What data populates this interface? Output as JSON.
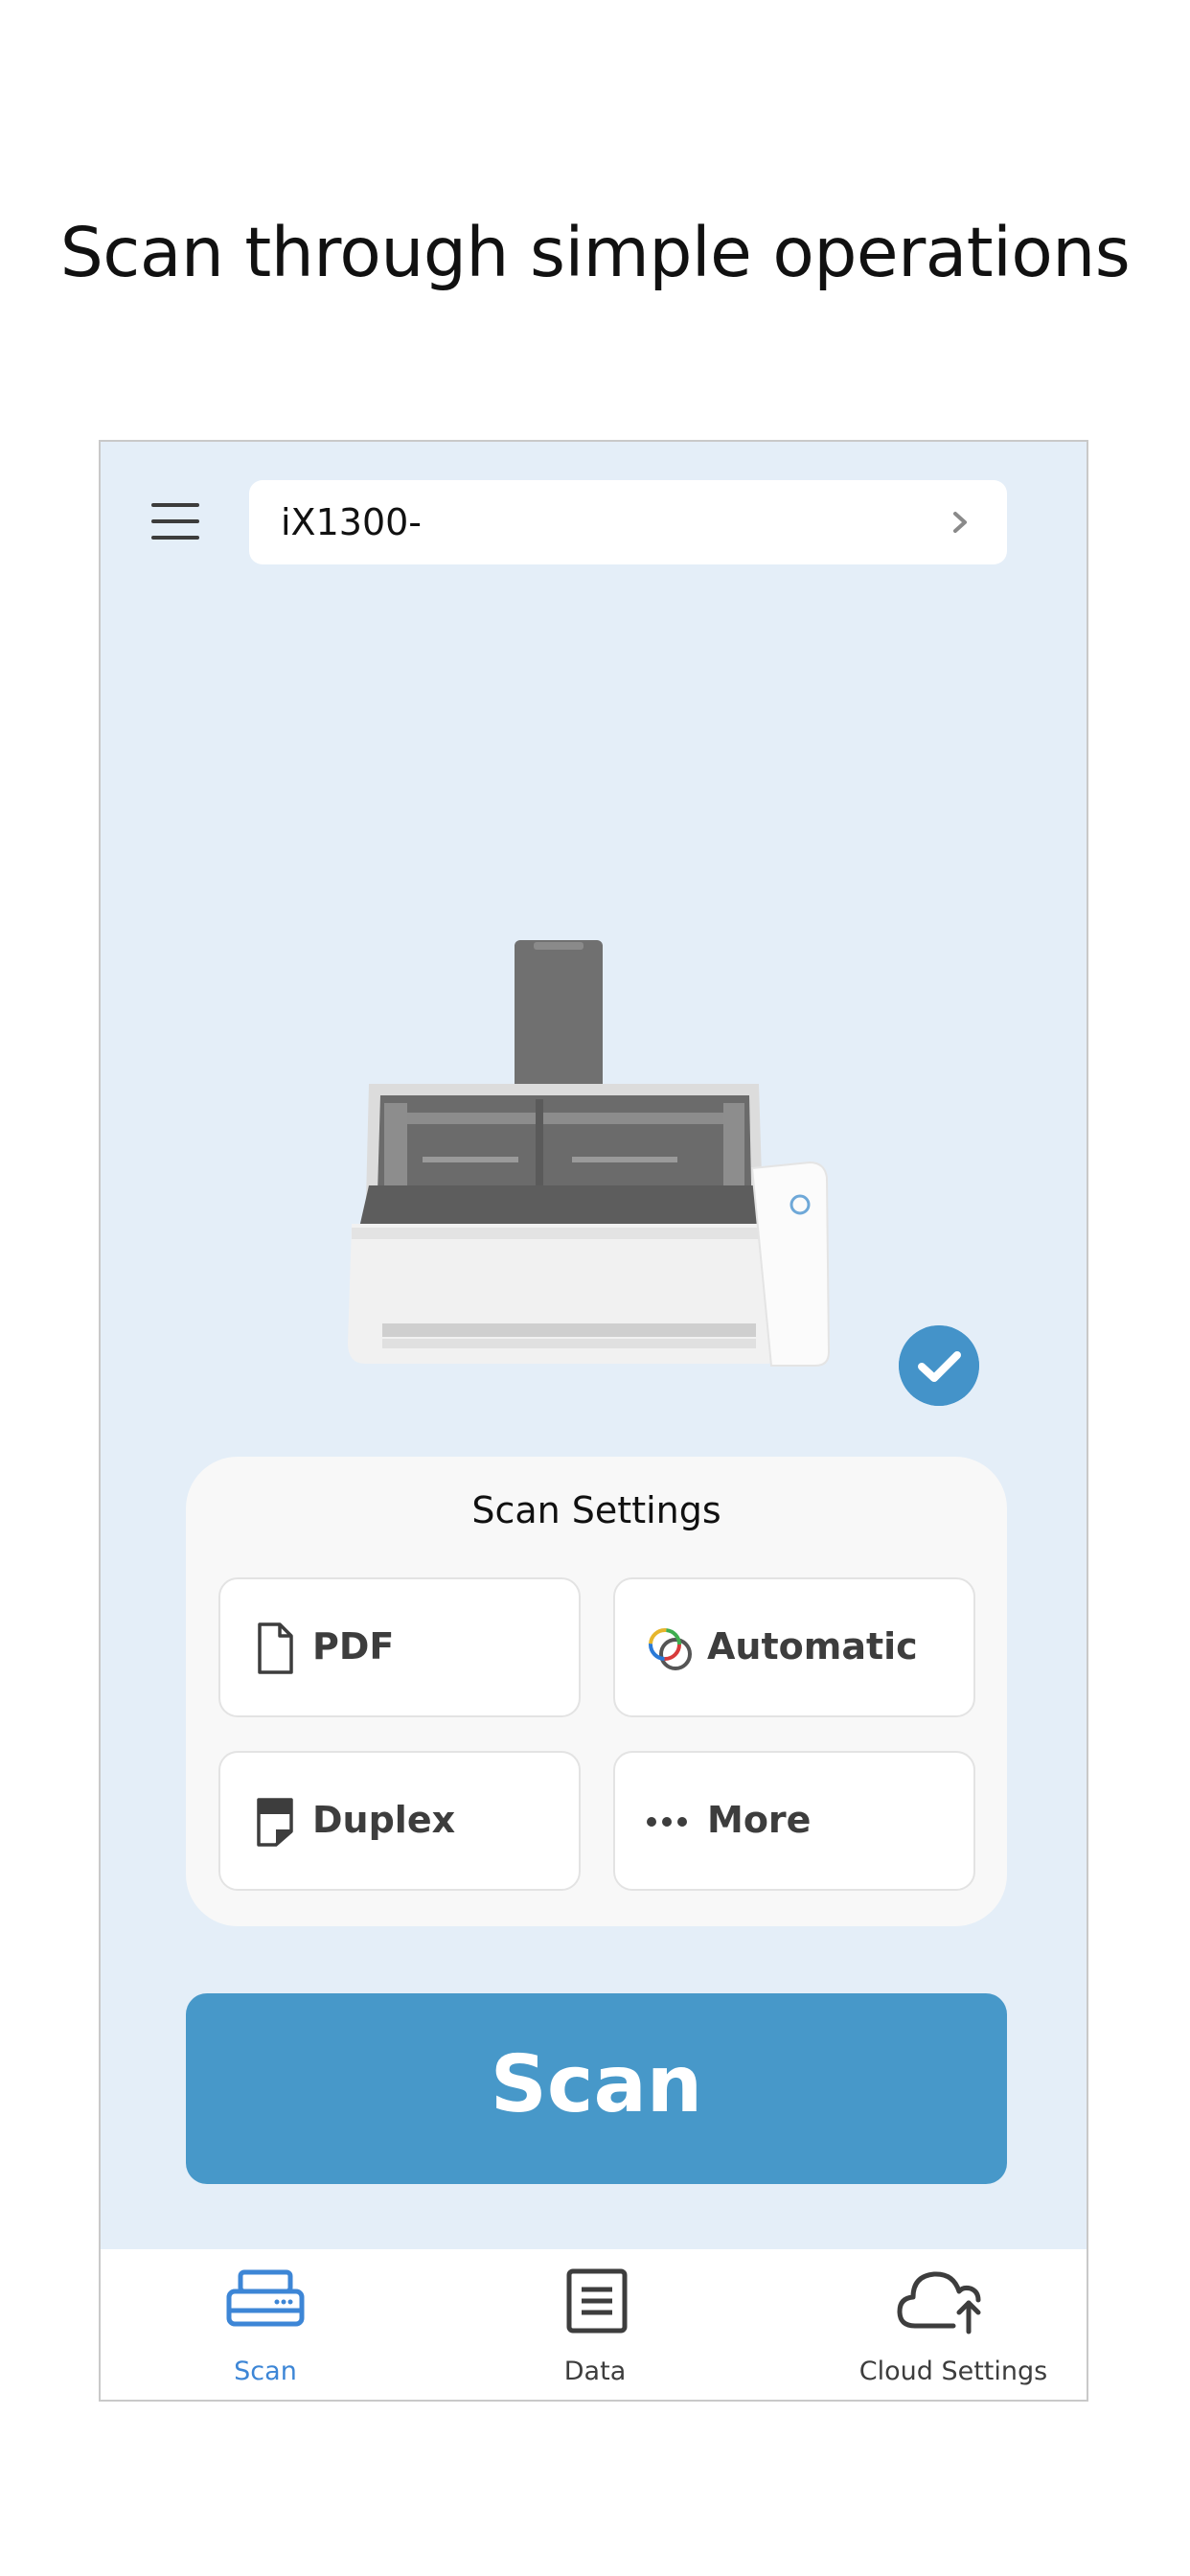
{
  "headline": "Scan through simple operations",
  "header": {
    "menu_icon": "hamburger-icon",
    "device_name": "iX1300-",
    "device_chevron_icon": "chevron-right-icon"
  },
  "device": {
    "image": "scanner-illustration",
    "status_icon": "check-circle-icon",
    "status_color": "#4493c9"
  },
  "scan_settings": {
    "title": "Scan Settings",
    "options": [
      {
        "label": "PDF",
        "icon": "document-icon"
      },
      {
        "label": "Automatic",
        "icon": "color-mode-icon"
      },
      {
        "label": "Duplex",
        "icon": "duplex-icon"
      },
      {
        "label": "More",
        "icon": "more-dots-icon"
      }
    ]
  },
  "scan_button": {
    "label": "Scan",
    "color": "#4798c9"
  },
  "tabbar": {
    "active_color": "#3d86d6",
    "tabs": [
      {
        "label": "Scan",
        "icon": "scanner-icon",
        "active": true
      },
      {
        "label": "Data",
        "icon": "list-document-icon",
        "active": false
      },
      {
        "label": "Cloud Settings",
        "icon": "cloud-upload-icon",
        "active": false
      }
    ]
  }
}
